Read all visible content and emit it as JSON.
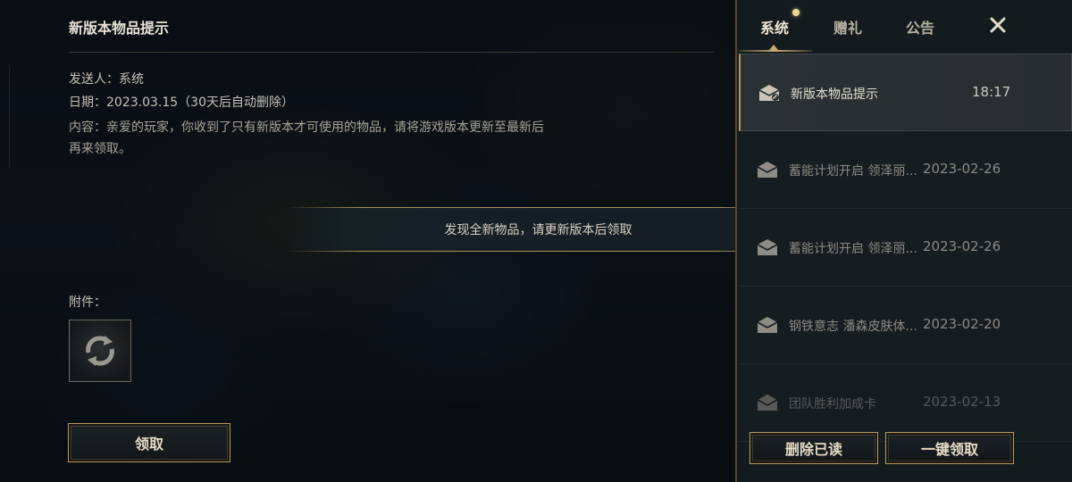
{
  "detail": {
    "title": "新版本物品提示",
    "sender": "发送人：系统",
    "date": "日期：2023.03.15（30天后自动删除）",
    "content": "内容：亲爱的玩家，你收到了只有新版本才可使用的物品，请将游戏版本更新至最新后再来领取。",
    "attachments_label": "附件：",
    "attachment_icon": "refresh-cycle-icon",
    "claim_label": "领取"
  },
  "toast": {
    "message": "发现全新物品，请更新版本后领取"
  },
  "sidebar": {
    "tabs": [
      {
        "label": "系统",
        "active": true,
        "has_dot": true
      },
      {
        "label": "赠礼",
        "active": false
      },
      {
        "label": "公告",
        "active": false
      }
    ],
    "mails": [
      {
        "subject": "新版本物品提示",
        "date": "18:17",
        "selected": true,
        "icon": "mail-read-icon"
      },
      {
        "subject": "蓄能计划开启 领泽丽...",
        "date": "2023-02-26",
        "selected": false,
        "icon": "mail-icon"
      },
      {
        "subject": "蓄能计划开启 领泽丽...",
        "date": "2023-02-26",
        "selected": false,
        "icon": "mail-icon"
      },
      {
        "subject": "钢铁意志 潘森皮肤体...",
        "date": "2023-02-20",
        "selected": false,
        "icon": "mail-icon"
      },
      {
        "subject": "团队胜利加成卡",
        "date": "2023-02-13",
        "selected": false,
        "icon": "mail-icon"
      }
    ],
    "delete_read_label": "删除已读",
    "claim_all_label": "一键领取"
  },
  "colors": {
    "accent_gold": "#b99b5b",
    "notification_dot": "#f2d888",
    "sidebar_bg": "#141b1f"
  }
}
